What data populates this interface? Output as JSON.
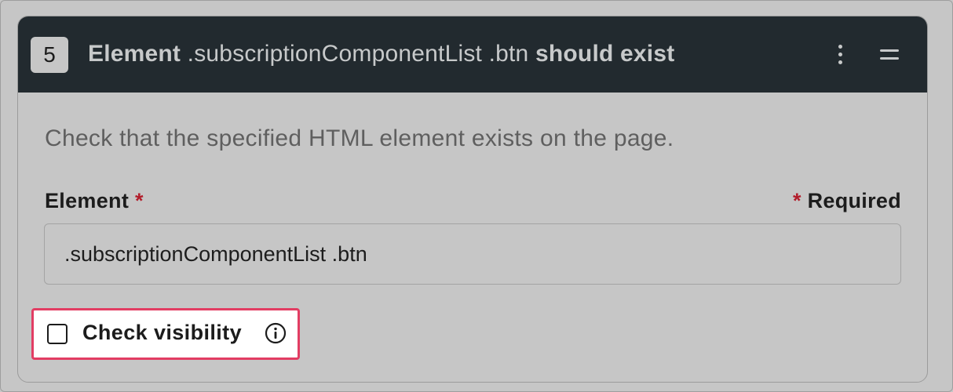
{
  "step": {
    "number": "5",
    "title_prefix": "Element",
    "selector": ".subscriptionComponentList .btn",
    "title_suffix": "should exist"
  },
  "body": {
    "description": "Check that the specified HTML element exists on the page.",
    "field_label": "Element",
    "required_marker": "*",
    "required_note": "Required",
    "element_value": ".subscriptionComponentList .btn",
    "check_visibility_label": "Check visibility",
    "check_visibility_checked": false
  },
  "icons": {
    "menu": "kebab-menu-icon",
    "drag": "drag-handle-icon",
    "info": "info-icon"
  },
  "colors": {
    "header_bg": "#222a2f",
    "highlight_border": "#e23d63",
    "required_asterisk": "#b21d2b"
  }
}
